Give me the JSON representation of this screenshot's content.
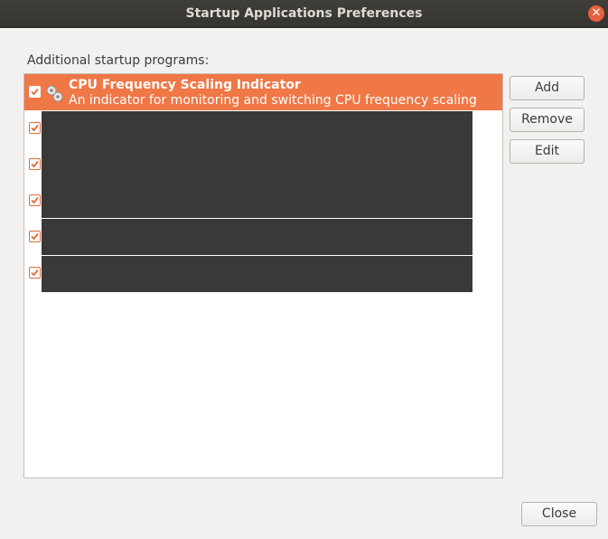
{
  "window": {
    "title": "Startup Applications Preferences"
  },
  "section_label": "Additional startup programs:",
  "programs": [
    {
      "name": "CPU Frequency Scaling Indicator",
      "description": "An indicator for monitoring and switching CPU frequency scaling",
      "enabled": true,
      "icon": "gear-icon"
    },
    {
      "enabled": true,
      "redacted": true
    },
    {
      "enabled": true,
      "redacted": true
    },
    {
      "enabled": true,
      "redacted": true
    },
    {
      "enabled": true,
      "redacted": true
    },
    {
      "enabled": true,
      "redacted": true
    }
  ],
  "buttons": {
    "add": "Add",
    "remove": "Remove",
    "edit": "Edit",
    "close": "Close"
  },
  "colors": {
    "accent": "#f07746",
    "titlebar": "#3f3e3a",
    "redaction": "#3a3939"
  }
}
